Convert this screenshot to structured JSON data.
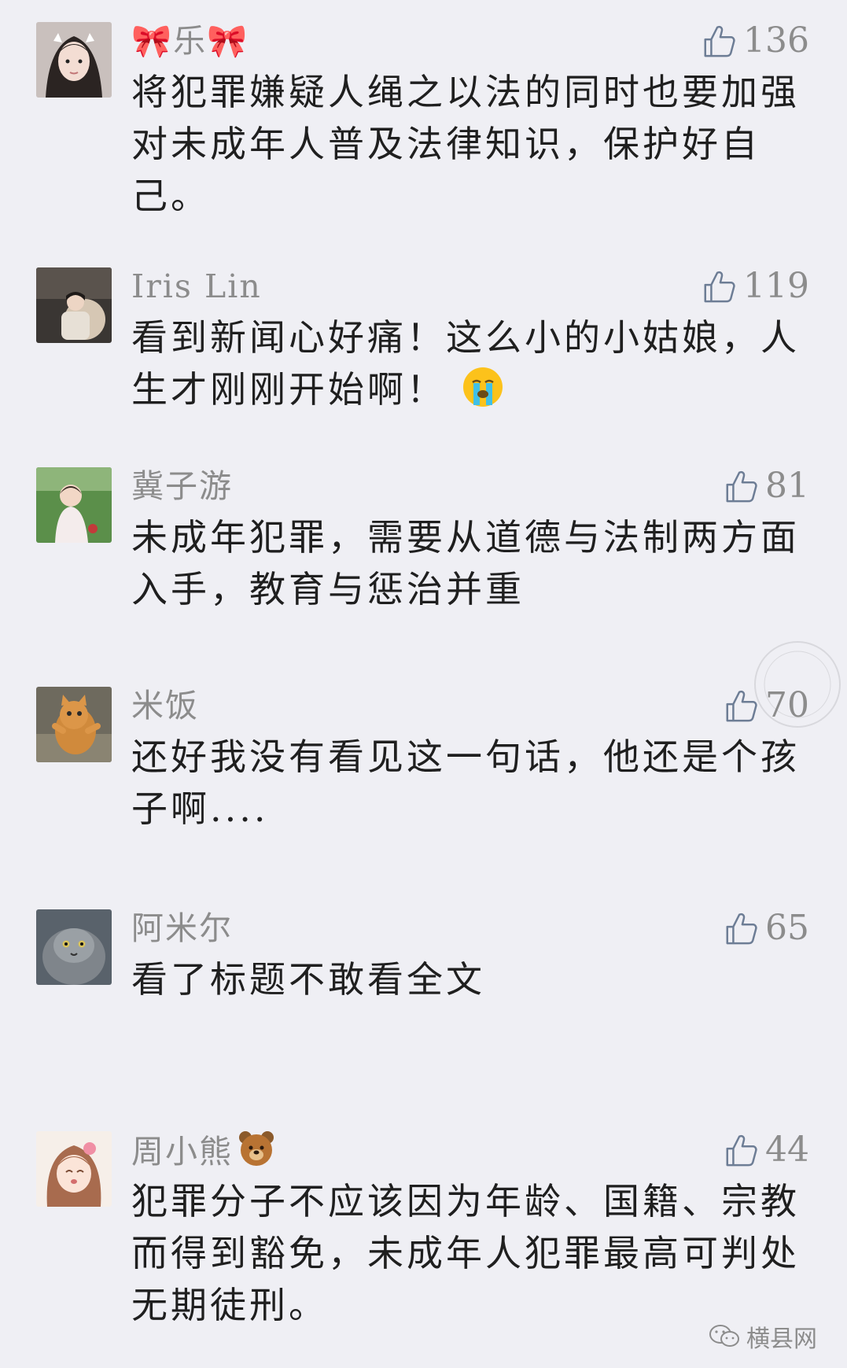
{
  "comments": [
    {
      "name": "乐",
      "name_prefix_emoji": "🎀",
      "name_suffix_emoji": "🎀",
      "likes": "136",
      "text": "将犯罪嫌疑人绳之以法的同时也要加强对未成年人普及法律知识，保护好自己。",
      "avatar": "avatar-woman-portrait"
    },
    {
      "name": "Iris Lin",
      "likes": "119",
      "text": "看到新闻心好痛！这么小的小姑娘，人生才刚刚开始啊！",
      "trailing_emoji": "crying-face-icon",
      "avatar": "avatar-girl-with-teddy-bear"
    },
    {
      "name": "冀子游",
      "likes": "81",
      "text": "未成年犯罪，需要从道德与法制两方面入手，教育与惩治并重",
      "avatar": "avatar-baby-on-grass"
    },
    {
      "name": "米饭",
      "likes": "70",
      "text": "还好我没有看见这一句话，他还是个孩子啊....",
      "avatar": "avatar-orange-cat"
    },
    {
      "name": "阿米尔",
      "likes": "65",
      "text": "看了标题不敢看全文",
      "avatar": "avatar-manul-cat"
    },
    {
      "name": "周小熊",
      "name_suffix_emoji": "bear-face-icon",
      "likes": "44",
      "text": "犯罪分子不应该因为年龄、国籍、宗教而得到豁免，未成年人犯罪最高可判处无期徒刑。",
      "avatar": "avatar-anime-girl"
    }
  ],
  "watermark": {
    "text": "横县网"
  },
  "footer": {
    "brand": "横县网"
  },
  "colors": {
    "background": "#efeff4",
    "name": "#8c8c8c",
    "text": "#1f1f1f"
  }
}
